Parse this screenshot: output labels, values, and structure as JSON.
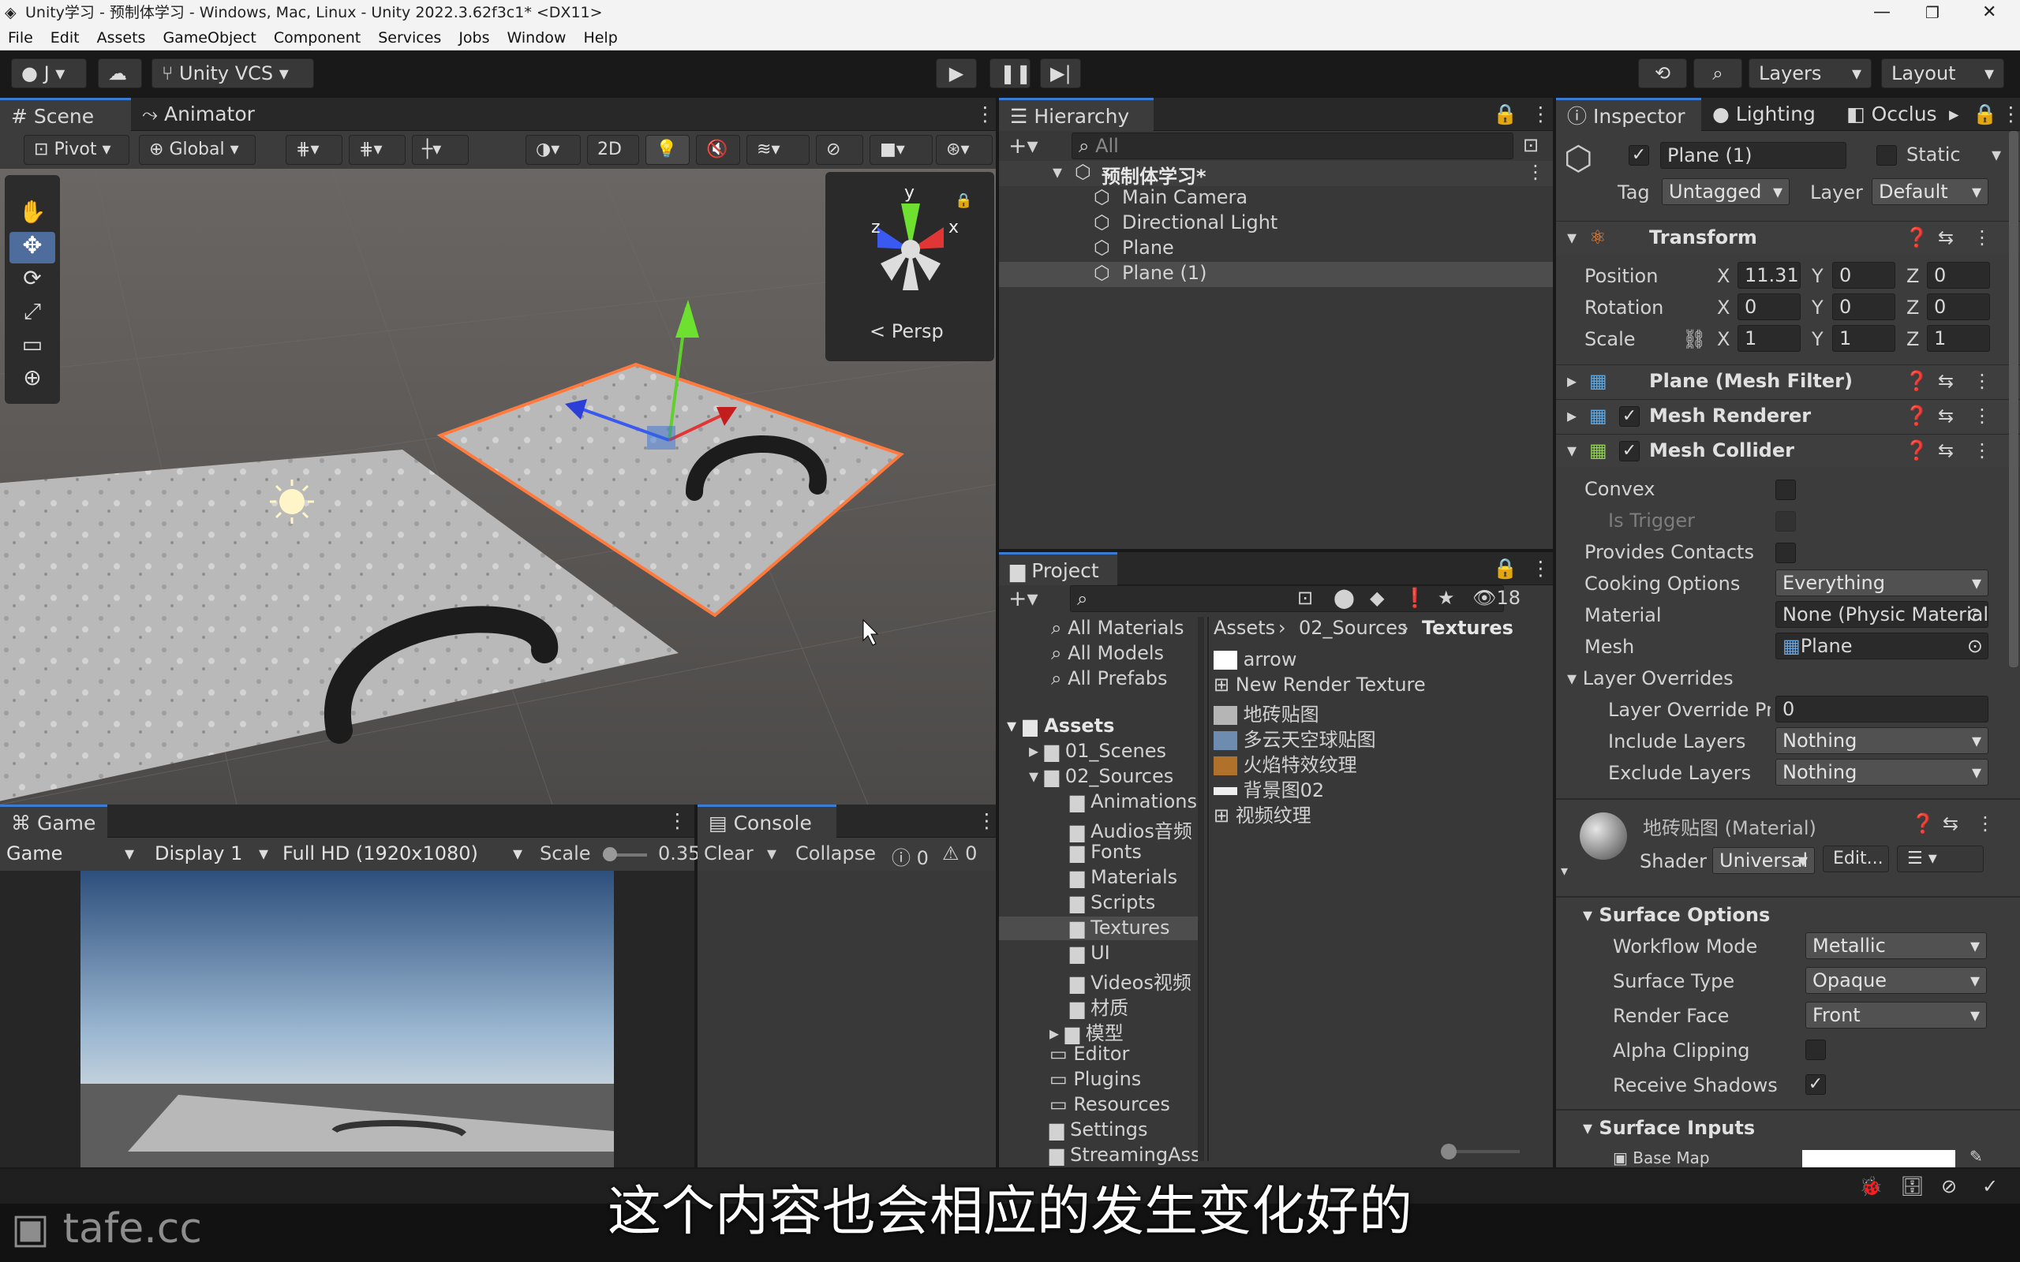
{
  "window": {
    "title": "Unity学习 - 预制体学习 - Windows, Mac, Linux - Unity 2022.3.62f3c1* <DX11>"
  },
  "menu": [
    "File",
    "Edit",
    "Assets",
    "GameObject",
    "Component",
    "Services",
    "Jobs",
    "Window",
    "Help"
  ],
  "toolbar": {
    "account": "J",
    "vcs": "Unity VCS",
    "layers": "Layers",
    "layout": "Layout"
  },
  "scene": {
    "tabs": [
      "Scene",
      "Animator"
    ],
    "pivot": "Pivot",
    "global": "Global",
    "mode2d": "2D",
    "persp": "< Persp",
    "gizmo": {
      "y": "y",
      "x": "x",
      "z": "z"
    }
  },
  "game": {
    "tab": "Game",
    "view": "Game",
    "display": "Display 1",
    "resolution": "Full HD (1920x1080)",
    "scale_label": "Scale",
    "scale_value": "0.35"
  },
  "console": {
    "tab": "Console",
    "clear": "Clear",
    "collapse": "Collapse",
    "count1": "0",
    "count2": "0"
  },
  "hierarchy": {
    "tab": "Hierarchy",
    "search": "All",
    "root": "预制体学习*",
    "items": [
      "Main Camera",
      "Directional Light",
      "Plane",
      "Plane (1)"
    ]
  },
  "project": {
    "tab": "Project",
    "count": "18",
    "favorites": [
      "All Materials",
      "All Models",
      "All Prefabs"
    ],
    "assets_label": "Assets",
    "folders": [
      "01_Scenes",
      "02_Sources",
      "Animations",
      "Audios音频",
      "Fonts",
      "Materials",
      "Scripts",
      "Textures",
      "UI",
      "Videos视频",
      "材质",
      "模型",
      "Editor",
      "Plugins",
      "Resources",
      "Settings",
      "StreamingAssets"
    ],
    "breadcrumb": [
      "Assets",
      "02_Sources",
      "Textures"
    ],
    "files": [
      "arrow",
      "New Render Texture",
      "地砖贴图",
      "多云天空球贴图",
      "火焰特效纹理",
      "背景图02",
      "视频纹理"
    ]
  },
  "inspector": {
    "tabs": [
      "Inspector",
      "Lighting",
      "Occlusion"
    ],
    "object_name": "Plane (1)",
    "static": "Static",
    "tag_label": "Tag",
    "tag": "Untagged",
    "layer_label": "Layer",
    "layer": "Default",
    "transform": {
      "title": "Transform",
      "position": {
        "label": "Position",
        "x": "11.31",
        "y": "0",
        "z": "0"
      },
      "rotation": {
        "label": "Rotation",
        "x": "0",
        "y": "0",
        "z": "0"
      },
      "scale": {
        "label": "Scale",
        "x": "1",
        "y": "1",
        "z": "1"
      }
    },
    "components": [
      "Plane (Mesh Filter)",
      "Mesh Renderer",
      "Mesh Collider"
    ],
    "collider": {
      "convex": "Convex",
      "is_trigger": "Is Trigger",
      "provides_contacts": "Provides Contacts",
      "cooking_label": "Cooking Options",
      "cooking": "Everything",
      "material_label": "Material",
      "material": "None (Physic Material)",
      "mesh_label": "Mesh",
      "mesh": "Plane",
      "layer_overrides": "Layer Overrides",
      "priority_label": "Layer Override Priority",
      "priority": "0",
      "include_label": "Include Layers",
      "include": "Nothing",
      "exclude_label": "Exclude Layers",
      "exclude": "Nothing"
    },
    "material": {
      "name": "地砖贴图 (Material)",
      "shader_label": "Shader",
      "shader": "Universal Render Pipeline/Lit",
      "edit": "Edit..."
    },
    "surface": {
      "title": "Surface Options",
      "workflow_label": "Workflow Mode",
      "workflow": "Metallic",
      "type_label": "Surface Type",
      "type": "Opaque",
      "face_label": "Render Face",
      "face": "Front",
      "alpha_label": "Alpha Clipping",
      "shadows_label": "Receive Shadows"
    },
    "inputs": {
      "title": "Surface Inputs",
      "base_map": "Base Map"
    }
  },
  "subtitle": "这个内容也会相应的发生变化好的",
  "watermark": "tafe.cc",
  "colors": {
    "accent": "#3a7bd5",
    "selection": "#ff7a3c",
    "panel": "#383838"
  }
}
